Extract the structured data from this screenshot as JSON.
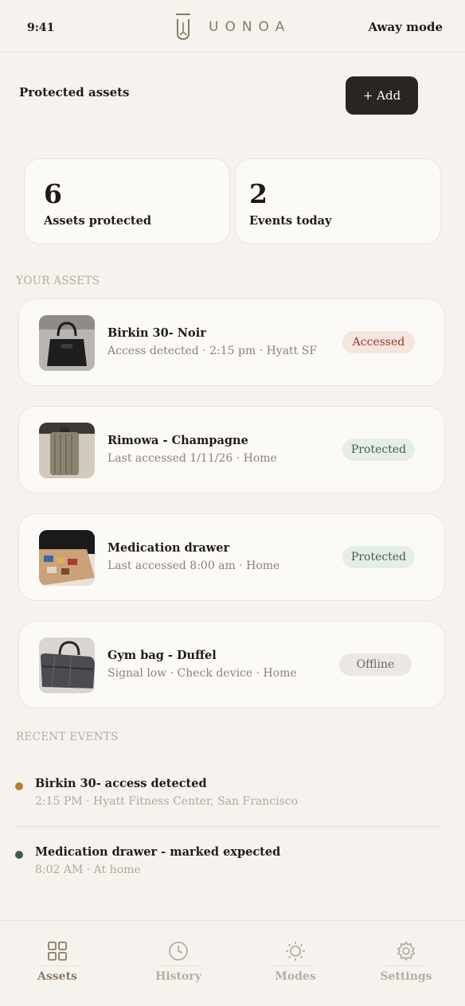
{
  "status": {
    "time": "9:41",
    "brand": "UONOA",
    "mode": "Away mode"
  },
  "header": {
    "title": "Protected assets",
    "add_label": "+ Add"
  },
  "stats": [
    {
      "value": "6",
      "label": "Assets protected"
    },
    {
      "value": "2",
      "label": "Events today"
    }
  ],
  "sections": {
    "assets": "YOUR ASSETS",
    "events": "RECENT EVENTS"
  },
  "assets": [
    {
      "name": "Birkin 30- Noir",
      "sub": "Access detected · 2:15 pm · Hyatt SF",
      "status": "Accessed"
    },
    {
      "name": "Rimowa - Champagne",
      "sub": "Last accessed 1/11/26 · Home",
      "status": "Protected"
    },
    {
      "name": "Medication drawer",
      "sub": "Last accessed 8:00 am · Home",
      "status": "Protected"
    },
    {
      "name": "Gym bag - Duffel",
      "sub": "Signal low · Check device · Home",
      "status": "Offline"
    }
  ],
  "events": [
    {
      "title": "Birkin 30- access detected",
      "sub": "2:15 PM · Hyatt Fitness Center, San Francisco",
      "dot_color": "#b5803a"
    },
    {
      "title": "Medication drawer - marked expected",
      "sub": "8:02 AM · At home",
      "dot_color": "#3f5c48"
    }
  ],
  "tabs": [
    {
      "label": "Assets",
      "icon": "grid-icon"
    },
    {
      "label": "History",
      "icon": "clock-icon"
    },
    {
      "label": "Modes",
      "icon": "sun-icon"
    },
    {
      "label": "Settings",
      "icon": "gear-icon"
    }
  ],
  "colors": {
    "accent": "#2a2522",
    "accessed_bg": "#f6e4df",
    "protected_bg": "#e5ede7",
    "offline_bg": "#ebe8e3"
  }
}
